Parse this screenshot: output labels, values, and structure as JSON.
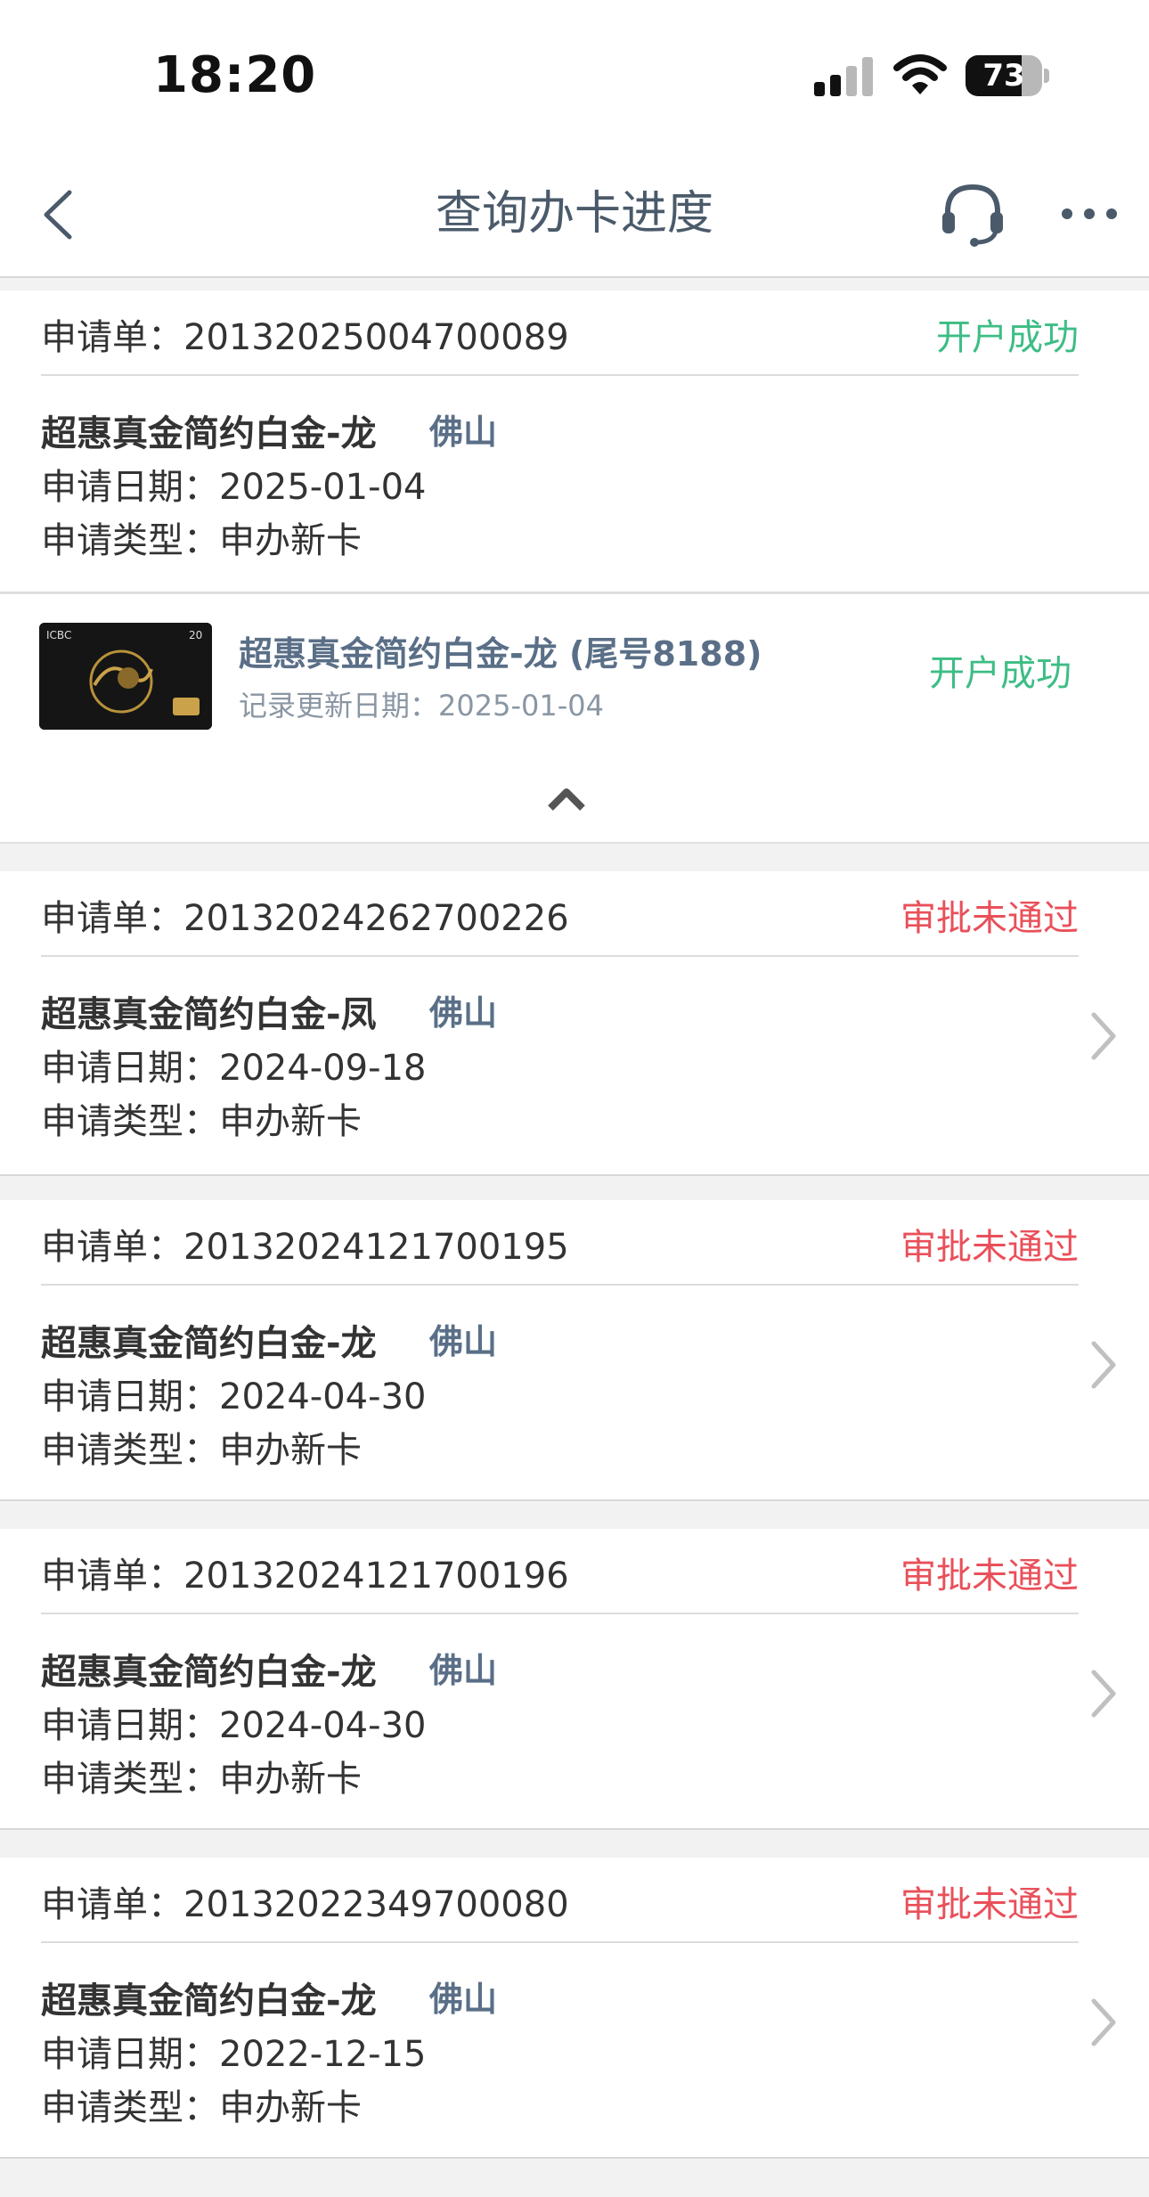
{
  "status_bar": {
    "time": "18:20",
    "battery": 73
  },
  "nav": {
    "title": "查询办卡进度",
    "back_icon": "chevron-left-icon",
    "service_icon": "headset-icon",
    "more_icon": "ellipsis-icon"
  },
  "colors": {
    "success": "#3dbd85",
    "fail": "#e9505a",
    "city": "#5a6f87"
  },
  "applications": [
    {
      "order_label": "申请单：",
      "order_no": "20132025004700089",
      "status": "开户成功",
      "product": "超惠真金简约白金-龙",
      "city": "佛山",
      "date_label": "申请日期：",
      "date": "2025-01-04",
      "type_label": "申请类型：",
      "type": "申办新卡",
      "card": {
        "name": "超惠真金简约白金-龙 (尾号8188)",
        "update_label": "记录更新日期：",
        "update_date": "2025-01-04",
        "status": "开户成功",
        "image_text": "ICBC"
      }
    },
    {
      "order_label": "申请单：",
      "order_no": "20132024262700226",
      "status": "审批未通过",
      "product": "超惠真金简约白金-凤",
      "city": "佛山",
      "date_label": "申请日期：",
      "date": "2024-09-18",
      "type_label": "申请类型：",
      "type": "申办新卡"
    },
    {
      "order_label": "申请单：",
      "order_no": "20132024121700195",
      "status": "审批未通过",
      "product": "超惠真金简约白金-龙",
      "city": "佛山",
      "date_label": "申请日期：",
      "date": "2024-04-30",
      "type_label": "申请类型：",
      "type": "申办新卡"
    },
    {
      "order_label": "申请单：",
      "order_no": "20132024121700196",
      "status": "审批未通过",
      "product": "超惠真金简约白金-龙",
      "city": "佛山",
      "date_label": "申请日期：",
      "date": "2024-04-30",
      "type_label": "申请类型：",
      "type": "申办新卡"
    },
    {
      "order_label": "申请单：",
      "order_no": "20132022349700080",
      "status": "审批未通过",
      "product": "超惠真金简约白金-龙",
      "city": "佛山",
      "date_label": "申请日期：",
      "date": "2022-12-15",
      "type_label": "申请类型：",
      "type": "申办新卡"
    }
  ]
}
